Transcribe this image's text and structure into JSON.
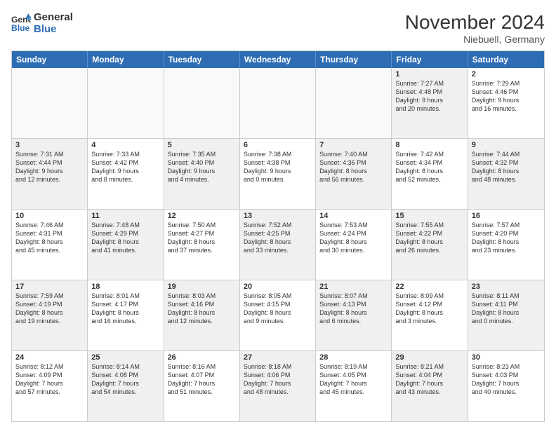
{
  "logo": {
    "line1": "General",
    "line2": "Blue"
  },
  "header": {
    "month": "November 2024",
    "location": "Niebuell, Germany"
  },
  "weekdays": [
    "Sunday",
    "Monday",
    "Tuesday",
    "Wednesday",
    "Thursday",
    "Friday",
    "Saturday"
  ],
  "rows": [
    [
      {
        "day": "",
        "info": ""
      },
      {
        "day": "",
        "info": ""
      },
      {
        "day": "",
        "info": ""
      },
      {
        "day": "",
        "info": ""
      },
      {
        "day": "",
        "info": ""
      },
      {
        "day": "1",
        "info": "Sunrise: 7:27 AM\nSunset: 4:48 PM\nDaylight: 9 hours\nand 20 minutes."
      },
      {
        "day": "2",
        "info": "Sunrise: 7:29 AM\nSunset: 4:46 PM\nDaylight: 9 hours\nand 16 minutes."
      }
    ],
    [
      {
        "day": "3",
        "info": "Sunrise: 7:31 AM\nSunset: 4:44 PM\nDaylight: 9 hours\nand 12 minutes."
      },
      {
        "day": "4",
        "info": "Sunrise: 7:33 AM\nSunset: 4:42 PM\nDaylight: 9 hours\nand 8 minutes."
      },
      {
        "day": "5",
        "info": "Sunrise: 7:35 AM\nSunset: 4:40 PM\nDaylight: 9 hours\nand 4 minutes."
      },
      {
        "day": "6",
        "info": "Sunrise: 7:38 AM\nSunset: 4:38 PM\nDaylight: 9 hours\nand 0 minutes."
      },
      {
        "day": "7",
        "info": "Sunrise: 7:40 AM\nSunset: 4:36 PM\nDaylight: 8 hours\nand 56 minutes."
      },
      {
        "day": "8",
        "info": "Sunrise: 7:42 AM\nSunset: 4:34 PM\nDaylight: 8 hours\nand 52 minutes."
      },
      {
        "day": "9",
        "info": "Sunrise: 7:44 AM\nSunset: 4:32 PM\nDaylight: 8 hours\nand 48 minutes."
      }
    ],
    [
      {
        "day": "10",
        "info": "Sunrise: 7:46 AM\nSunset: 4:31 PM\nDaylight: 8 hours\nand 45 minutes."
      },
      {
        "day": "11",
        "info": "Sunrise: 7:48 AM\nSunset: 4:29 PM\nDaylight: 8 hours\nand 41 minutes."
      },
      {
        "day": "12",
        "info": "Sunrise: 7:50 AM\nSunset: 4:27 PM\nDaylight: 8 hours\nand 37 minutes."
      },
      {
        "day": "13",
        "info": "Sunrise: 7:52 AM\nSunset: 4:25 PM\nDaylight: 8 hours\nand 33 minutes."
      },
      {
        "day": "14",
        "info": "Sunrise: 7:53 AM\nSunset: 4:24 PM\nDaylight: 8 hours\nand 30 minutes."
      },
      {
        "day": "15",
        "info": "Sunrise: 7:55 AM\nSunset: 4:22 PM\nDaylight: 8 hours\nand 26 minutes."
      },
      {
        "day": "16",
        "info": "Sunrise: 7:57 AM\nSunset: 4:20 PM\nDaylight: 8 hours\nand 23 minutes."
      }
    ],
    [
      {
        "day": "17",
        "info": "Sunrise: 7:59 AM\nSunset: 4:19 PM\nDaylight: 8 hours\nand 19 minutes."
      },
      {
        "day": "18",
        "info": "Sunrise: 8:01 AM\nSunset: 4:17 PM\nDaylight: 8 hours\nand 16 minutes."
      },
      {
        "day": "19",
        "info": "Sunrise: 8:03 AM\nSunset: 4:16 PM\nDaylight: 8 hours\nand 12 minutes."
      },
      {
        "day": "20",
        "info": "Sunrise: 8:05 AM\nSunset: 4:15 PM\nDaylight: 8 hours\nand 9 minutes."
      },
      {
        "day": "21",
        "info": "Sunrise: 8:07 AM\nSunset: 4:13 PM\nDaylight: 8 hours\nand 6 minutes."
      },
      {
        "day": "22",
        "info": "Sunrise: 8:09 AM\nSunset: 4:12 PM\nDaylight: 8 hours\nand 3 minutes."
      },
      {
        "day": "23",
        "info": "Sunrise: 8:11 AM\nSunset: 4:11 PM\nDaylight: 8 hours\nand 0 minutes."
      }
    ],
    [
      {
        "day": "24",
        "info": "Sunrise: 8:12 AM\nSunset: 4:09 PM\nDaylight: 7 hours\nand 57 minutes."
      },
      {
        "day": "25",
        "info": "Sunrise: 8:14 AM\nSunset: 4:08 PM\nDaylight: 7 hours\nand 54 minutes."
      },
      {
        "day": "26",
        "info": "Sunrise: 8:16 AM\nSunset: 4:07 PM\nDaylight: 7 hours\nand 51 minutes."
      },
      {
        "day": "27",
        "info": "Sunrise: 8:18 AM\nSunset: 4:06 PM\nDaylight: 7 hours\nand 48 minutes."
      },
      {
        "day": "28",
        "info": "Sunrise: 8:19 AM\nSunset: 4:05 PM\nDaylight: 7 hours\nand 45 minutes."
      },
      {
        "day": "29",
        "info": "Sunrise: 8:21 AM\nSunset: 4:04 PM\nDaylight: 7 hours\nand 43 minutes."
      },
      {
        "day": "30",
        "info": "Sunrise: 8:23 AM\nSunset: 4:03 PM\nDaylight: 7 hours\nand 40 minutes."
      }
    ]
  ]
}
